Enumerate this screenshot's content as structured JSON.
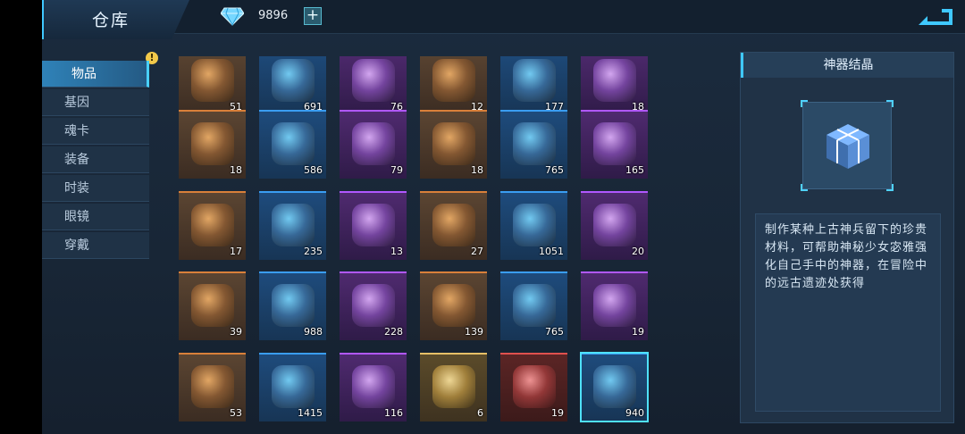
{
  "header": {
    "title": "仓库",
    "currency": {
      "icon": "diamond-icon",
      "amount": "9896",
      "add_label": "+"
    },
    "back_icon": "back-arrow-icon"
  },
  "sidebar": {
    "badge": "!",
    "items": [
      {
        "label": "物品",
        "active": true
      },
      {
        "label": "基因",
        "active": false
      },
      {
        "label": "魂卡",
        "active": false
      },
      {
        "label": "装备",
        "active": false
      },
      {
        "label": "时装",
        "active": false
      },
      {
        "label": "眼镜",
        "active": false
      },
      {
        "label": "穿戴",
        "active": false
      }
    ]
  },
  "inventory": {
    "rarity_colors": {
      "orange": "#d9803a",
      "blue": "#3a9df2",
      "purple": "#b158ff",
      "gold": "#e7c067",
      "red": "#e0514e"
    },
    "rows": [
      [
        {
          "q": "51",
          "r": "orange"
        },
        {
          "q": "691",
          "r": "blue"
        },
        {
          "q": "76",
          "r": "purple"
        },
        {
          "q": "12",
          "r": "orange"
        },
        {
          "q": "177",
          "r": "blue"
        },
        {
          "q": "18",
          "r": "purple"
        }
      ],
      [
        {
          "q": "18",
          "r": "orange"
        },
        {
          "q": "586",
          "r": "blue"
        },
        {
          "q": "79",
          "r": "purple"
        },
        {
          "q": "18",
          "r": "orange"
        },
        {
          "q": "765",
          "r": "blue"
        },
        {
          "q": "165",
          "r": "purple"
        }
      ],
      [
        {
          "q": "17",
          "r": "orange"
        },
        {
          "q": "235",
          "r": "blue"
        },
        {
          "q": "13",
          "r": "purple"
        },
        {
          "q": "27",
          "r": "orange"
        },
        {
          "q": "1051",
          "r": "blue"
        },
        {
          "q": "20",
          "r": "purple"
        }
      ],
      [
        {
          "q": "39",
          "r": "orange"
        },
        {
          "q": "988",
          "r": "blue"
        },
        {
          "q": "228",
          "r": "purple"
        },
        {
          "q": "139",
          "r": "orange"
        },
        {
          "q": "765",
          "r": "blue"
        },
        {
          "q": "19",
          "r": "purple"
        }
      ],
      [
        {
          "q": "53",
          "r": "orange"
        },
        {
          "q": "1415",
          "r": "blue"
        },
        {
          "q": "116",
          "r": "purple"
        },
        {
          "q": "6",
          "r": "gold"
        },
        {
          "q": "19",
          "r": "red"
        },
        {
          "q": "940",
          "r": "blue",
          "selected": true
        }
      ]
    ]
  },
  "detail": {
    "title": "神器结晶",
    "description": "制作某种上古神兵留下的珍贵材料，可帮助神秘少女宓雅强化自己手中的神器，在冒险中的远古遗迹处获得"
  }
}
